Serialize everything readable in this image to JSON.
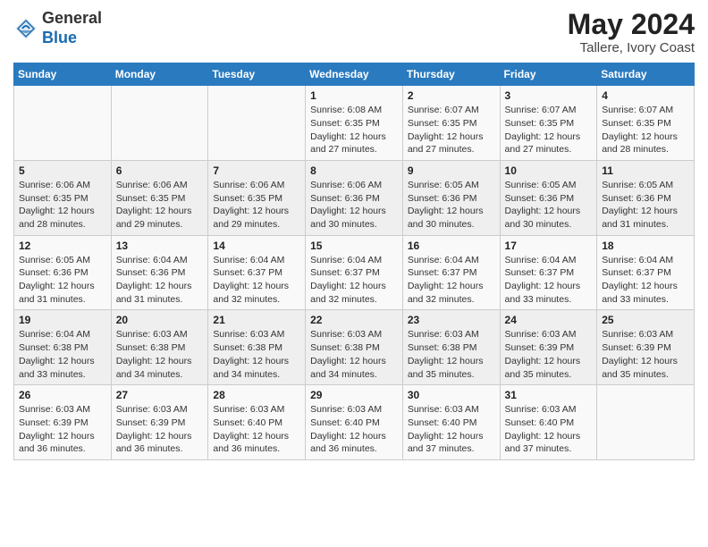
{
  "header": {
    "logo_general": "General",
    "logo_blue": "Blue",
    "month_year": "May 2024",
    "location": "Tallere, Ivory Coast"
  },
  "calendar": {
    "days_of_week": [
      "Sunday",
      "Monday",
      "Tuesday",
      "Wednesday",
      "Thursday",
      "Friday",
      "Saturday"
    ],
    "weeks": [
      [
        {
          "day": "",
          "info": ""
        },
        {
          "day": "",
          "info": ""
        },
        {
          "day": "",
          "info": ""
        },
        {
          "day": "1",
          "info": "Sunrise: 6:08 AM\nSunset: 6:35 PM\nDaylight: 12 hours\nand 27 minutes."
        },
        {
          "day": "2",
          "info": "Sunrise: 6:07 AM\nSunset: 6:35 PM\nDaylight: 12 hours\nand 27 minutes."
        },
        {
          "day": "3",
          "info": "Sunrise: 6:07 AM\nSunset: 6:35 PM\nDaylight: 12 hours\nand 27 minutes."
        },
        {
          "day": "4",
          "info": "Sunrise: 6:07 AM\nSunset: 6:35 PM\nDaylight: 12 hours\nand 28 minutes."
        }
      ],
      [
        {
          "day": "5",
          "info": "Sunrise: 6:06 AM\nSunset: 6:35 PM\nDaylight: 12 hours\nand 28 minutes."
        },
        {
          "day": "6",
          "info": "Sunrise: 6:06 AM\nSunset: 6:35 PM\nDaylight: 12 hours\nand 29 minutes."
        },
        {
          "day": "7",
          "info": "Sunrise: 6:06 AM\nSunset: 6:35 PM\nDaylight: 12 hours\nand 29 minutes."
        },
        {
          "day": "8",
          "info": "Sunrise: 6:06 AM\nSunset: 6:36 PM\nDaylight: 12 hours\nand 30 minutes."
        },
        {
          "day": "9",
          "info": "Sunrise: 6:05 AM\nSunset: 6:36 PM\nDaylight: 12 hours\nand 30 minutes."
        },
        {
          "day": "10",
          "info": "Sunrise: 6:05 AM\nSunset: 6:36 PM\nDaylight: 12 hours\nand 30 minutes."
        },
        {
          "day": "11",
          "info": "Sunrise: 6:05 AM\nSunset: 6:36 PM\nDaylight: 12 hours\nand 31 minutes."
        }
      ],
      [
        {
          "day": "12",
          "info": "Sunrise: 6:05 AM\nSunset: 6:36 PM\nDaylight: 12 hours\nand 31 minutes."
        },
        {
          "day": "13",
          "info": "Sunrise: 6:04 AM\nSunset: 6:36 PM\nDaylight: 12 hours\nand 31 minutes."
        },
        {
          "day": "14",
          "info": "Sunrise: 6:04 AM\nSunset: 6:37 PM\nDaylight: 12 hours\nand 32 minutes."
        },
        {
          "day": "15",
          "info": "Sunrise: 6:04 AM\nSunset: 6:37 PM\nDaylight: 12 hours\nand 32 minutes."
        },
        {
          "day": "16",
          "info": "Sunrise: 6:04 AM\nSunset: 6:37 PM\nDaylight: 12 hours\nand 32 minutes."
        },
        {
          "day": "17",
          "info": "Sunrise: 6:04 AM\nSunset: 6:37 PM\nDaylight: 12 hours\nand 33 minutes."
        },
        {
          "day": "18",
          "info": "Sunrise: 6:04 AM\nSunset: 6:37 PM\nDaylight: 12 hours\nand 33 minutes."
        }
      ],
      [
        {
          "day": "19",
          "info": "Sunrise: 6:04 AM\nSunset: 6:38 PM\nDaylight: 12 hours\nand 33 minutes."
        },
        {
          "day": "20",
          "info": "Sunrise: 6:03 AM\nSunset: 6:38 PM\nDaylight: 12 hours\nand 34 minutes."
        },
        {
          "day": "21",
          "info": "Sunrise: 6:03 AM\nSunset: 6:38 PM\nDaylight: 12 hours\nand 34 minutes."
        },
        {
          "day": "22",
          "info": "Sunrise: 6:03 AM\nSunset: 6:38 PM\nDaylight: 12 hours\nand 34 minutes."
        },
        {
          "day": "23",
          "info": "Sunrise: 6:03 AM\nSunset: 6:38 PM\nDaylight: 12 hours\nand 35 minutes."
        },
        {
          "day": "24",
          "info": "Sunrise: 6:03 AM\nSunset: 6:39 PM\nDaylight: 12 hours\nand 35 minutes."
        },
        {
          "day": "25",
          "info": "Sunrise: 6:03 AM\nSunset: 6:39 PM\nDaylight: 12 hours\nand 35 minutes."
        }
      ],
      [
        {
          "day": "26",
          "info": "Sunrise: 6:03 AM\nSunset: 6:39 PM\nDaylight: 12 hours\nand 36 minutes."
        },
        {
          "day": "27",
          "info": "Sunrise: 6:03 AM\nSunset: 6:39 PM\nDaylight: 12 hours\nand 36 minutes."
        },
        {
          "day": "28",
          "info": "Sunrise: 6:03 AM\nSunset: 6:40 PM\nDaylight: 12 hours\nand 36 minutes."
        },
        {
          "day": "29",
          "info": "Sunrise: 6:03 AM\nSunset: 6:40 PM\nDaylight: 12 hours\nand 36 minutes."
        },
        {
          "day": "30",
          "info": "Sunrise: 6:03 AM\nSunset: 6:40 PM\nDaylight: 12 hours\nand 37 minutes."
        },
        {
          "day": "31",
          "info": "Sunrise: 6:03 AM\nSunset: 6:40 PM\nDaylight: 12 hours\nand 37 minutes."
        },
        {
          "day": "",
          "info": ""
        }
      ]
    ]
  }
}
